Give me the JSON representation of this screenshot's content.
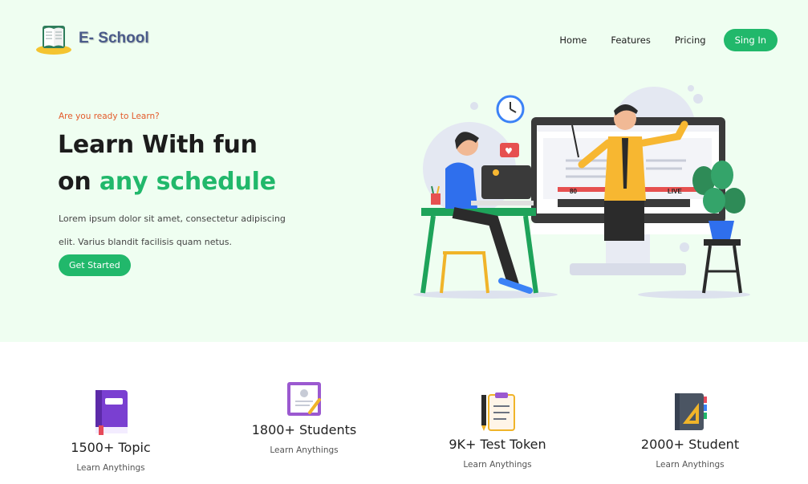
{
  "brand": {
    "name": "E- School",
    "logo_icon": "open-book-icon"
  },
  "nav": {
    "items": [
      "Home",
      "Features",
      "Pricing"
    ],
    "cta": "Sing In"
  },
  "hero": {
    "eyebrow": "Are you ready to Learn?",
    "line1": "Learn With fun",
    "line2_prefix": "on",
    "line2_accent": "any schedule",
    "description": "Lorem ipsum dolor sit amet, consectetur adipiscing elit. Varius blandit facilisis quam netus.",
    "cta": "Get Started"
  },
  "illustration": {
    "viewer_count": "80",
    "live_label": "LIVE"
  },
  "stats": [
    {
      "icon": "purple-book-icon",
      "title": "1500+ Topic",
      "subtitle": "Learn Anythings"
    },
    {
      "icon": "certificate-icon",
      "title": "1800+ Students",
      "subtitle": "Learn Anythings"
    },
    {
      "icon": "clipboard-pen-icon",
      "title": "9K+ Test Token",
      "subtitle": "Learn Anythings"
    },
    {
      "icon": "notebook-ruler-icon",
      "title": "2000+ Student",
      "subtitle": "Learn Anythings"
    }
  ],
  "colors": {
    "accent": "#21b86b",
    "hero_bg": "#effef1",
    "eyebrow": "#e35a2a",
    "text": "#1c1c1c"
  }
}
